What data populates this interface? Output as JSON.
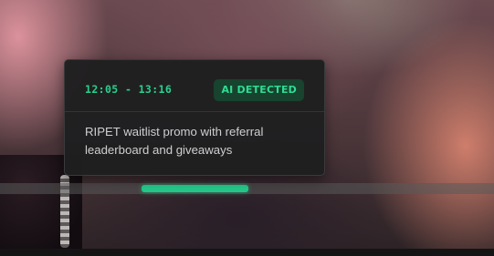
{
  "tooltip": {
    "time_range": "12:05 - 13:16",
    "badge_label": "AI DETECTED",
    "description": "RIPET waitlist promo with referral leaderboard and giveaways"
  },
  "colors": {
    "accent_green": "#24c98a",
    "badge_background": "#17432f",
    "tooltip_background": "#1f1f20"
  }
}
